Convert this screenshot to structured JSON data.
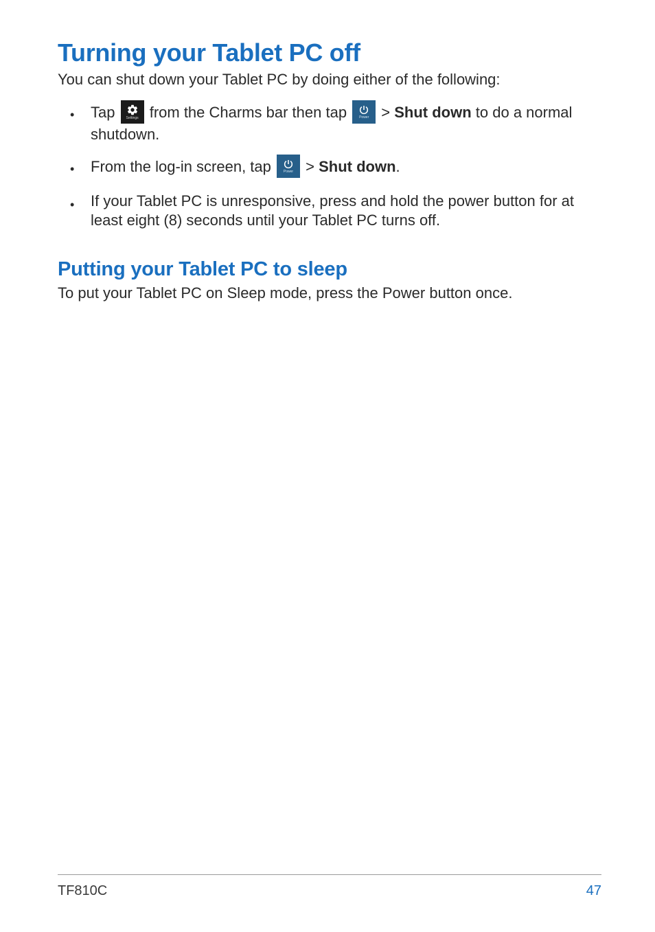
{
  "h1": "Turning your Tablet PC off",
  "intro": "You can shut down your Tablet PC by doing either of the following:",
  "items": {
    "i1": {
      "p1": "Tap ",
      "p2": " from the Charms bar then tap ",
      "p3": " > ",
      "bold": "Shut down",
      "p4": " to do a normal shutdown."
    },
    "i2": {
      "p1": "From the log-in screen, tap ",
      "p2": " > ",
      "bold": "Shut down",
      "p3": "."
    },
    "i3": "If your Tablet PC is unresponsive, press and hold the power  button for at least eight (8) seconds until your Tablet PC turns off."
  },
  "h2": "Putting your Tablet PC to sleep",
  "body2": "To put your Tablet PC on Sleep mode, press the Power button once.",
  "icons": {
    "settings_caption": "Settings",
    "power_caption": "Power"
  },
  "footer": {
    "model": "TF810C",
    "page": "47"
  }
}
